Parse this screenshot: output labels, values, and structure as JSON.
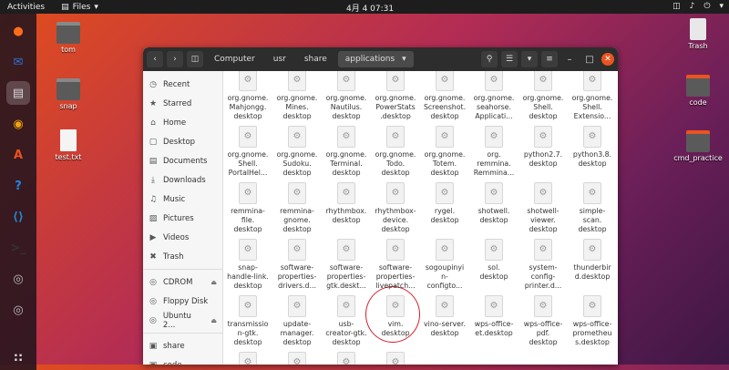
{
  "topbar": {
    "activities": "Activities",
    "app_menu": "Files",
    "clock": "4月 4  07:31"
  },
  "dock": [
    {
      "name": "firefox-icon",
      "glyph": "●",
      "color": "#ff6d1b",
      "active": false
    },
    {
      "name": "thunderbird-icon",
      "glyph": "✉",
      "color": "#2e74d6",
      "active": false
    },
    {
      "name": "files-icon",
      "glyph": "▤",
      "color": "#d9d9d9",
      "active": true
    },
    {
      "name": "rhythmbox-icon",
      "glyph": "◉",
      "color": "#f0a30a",
      "active": false
    },
    {
      "name": "software-icon",
      "glyph": "A",
      "color": "#e95420",
      "active": false
    },
    {
      "name": "help-icon",
      "glyph": "?",
      "color": "#1e88e5",
      "active": false
    },
    {
      "name": "vscode-icon",
      "glyph": "⟨⟩",
      "color": "#1f8ad2",
      "active": false
    },
    {
      "name": "terminal-icon",
      "glyph": ">_",
      "color": "#333333",
      "active": false
    },
    {
      "name": "dvd-icon",
      "glyph": "◎",
      "color": "#bbbbbb",
      "active": false
    },
    {
      "name": "dvd-icon",
      "glyph": "◎",
      "color": "#bbbbbb",
      "active": false
    }
  ],
  "desktop": {
    "tom": "tom",
    "snap": "snap",
    "test": "test.txt",
    "trash": "Trash",
    "code": "code",
    "cmd": "cmd_practice"
  },
  "breadcrumbs": [
    "Computer",
    "usr",
    "share",
    "applications"
  ],
  "sidebar": [
    {
      "icon": "clock-icon",
      "glyph": "◷",
      "label": "Recent"
    },
    {
      "icon": "star-icon",
      "glyph": "★",
      "label": "Starred"
    },
    {
      "icon": "home-icon",
      "glyph": "⌂",
      "label": "Home"
    },
    {
      "icon": "desktop-icon",
      "glyph": "▢",
      "label": "Desktop"
    },
    {
      "icon": "documents-icon",
      "glyph": "▤",
      "label": "Documents"
    },
    {
      "icon": "downloads-icon",
      "glyph": "⤓",
      "label": "Downloads"
    },
    {
      "icon": "music-icon",
      "glyph": "♫",
      "label": "Music"
    },
    {
      "icon": "pictures-icon",
      "glyph": "▨",
      "label": "Pictures"
    },
    {
      "icon": "videos-icon",
      "glyph": "▶",
      "label": "Videos"
    },
    {
      "icon": "trash-icon",
      "glyph": "✖",
      "label": "Trash"
    },
    {
      "icon": "cdrom-icon",
      "glyph": "◎",
      "label": "CDROM",
      "eject": true,
      "sep_before": true
    },
    {
      "icon": "floppy-icon",
      "glyph": "◎",
      "label": "Floppy Disk"
    },
    {
      "icon": "ubuntu-disk-icon",
      "glyph": "◎",
      "label": "Ubuntu 2...",
      "eject": true
    },
    {
      "icon": "share-folder-icon",
      "glyph": "▣",
      "label": "share",
      "sep_before": true
    },
    {
      "icon": "code-folder-icon",
      "glyph": "▣",
      "label": "code"
    }
  ],
  "files": [
    [
      "org.gnome.\nMahjongg.\ndesktop",
      "org.gnome.\nMines.\ndesktop",
      "org.gnome.\nNautilus.\ndesktop",
      "org.gnome.\nPowerStats\n.desktop",
      "org.gnome.\nScreenshot.\ndesktop",
      "org.gnome.\nseahorse.\nApplicati...",
      "org.gnome.\nShell.\ndesktop",
      "org.gnome.\nShell.\nExtensio..."
    ],
    [
      "org.gnome.\nShell.\nPortalHel...",
      "org.gnome.\nSudoku.\ndesktop",
      "org.gnome.\nTerminal.\ndesktop",
      "org.gnome.\nTodo.\ndesktop",
      "org.gnome.\nTotem.\ndesktop",
      "org.\nremmina.\nRemmina...",
      "python2.7.\ndesktop",
      "python3.8.\ndesktop"
    ],
    [
      "remmina-\nfile.\ndesktop",
      "remmina-\ngnome.\ndesktop",
      "rhythmbox.\ndesktop",
      "rhythmbox-\ndevice.\ndesktop",
      "rygel.\ndesktop",
      "shotwell.\ndesktop",
      "shotwell-\nviewer.\ndesktop",
      "simple-\nscan.\ndesktop"
    ],
    [
      "snap-\nhandle-link.\ndesktop",
      "software-\nproperties-\ndrivers.d...",
      "software-\nproperties-\ngtk.deskt...",
      "software-\nproperties-\nlivepatch...",
      "sogoupinyi\nn-\nconfigto...",
      "sol.\ndesktop",
      "system-\nconfig-\nprinter.d...",
      "thunderbir\nd.desktop"
    ],
    [
      "transmissio\nn-gtk.\ndesktop",
      "update-\nmanager.\ndesktop",
      "usb-\ncreator-gtk.\ndesktop",
      "vim.\ndesktop",
      "vino-server.\ndesktop",
      "wps-office-\net.desktop",
      "wps-office-\npdf.\ndesktop",
      "wps-office-\nprometheu\ns.desktop"
    ]
  ]
}
